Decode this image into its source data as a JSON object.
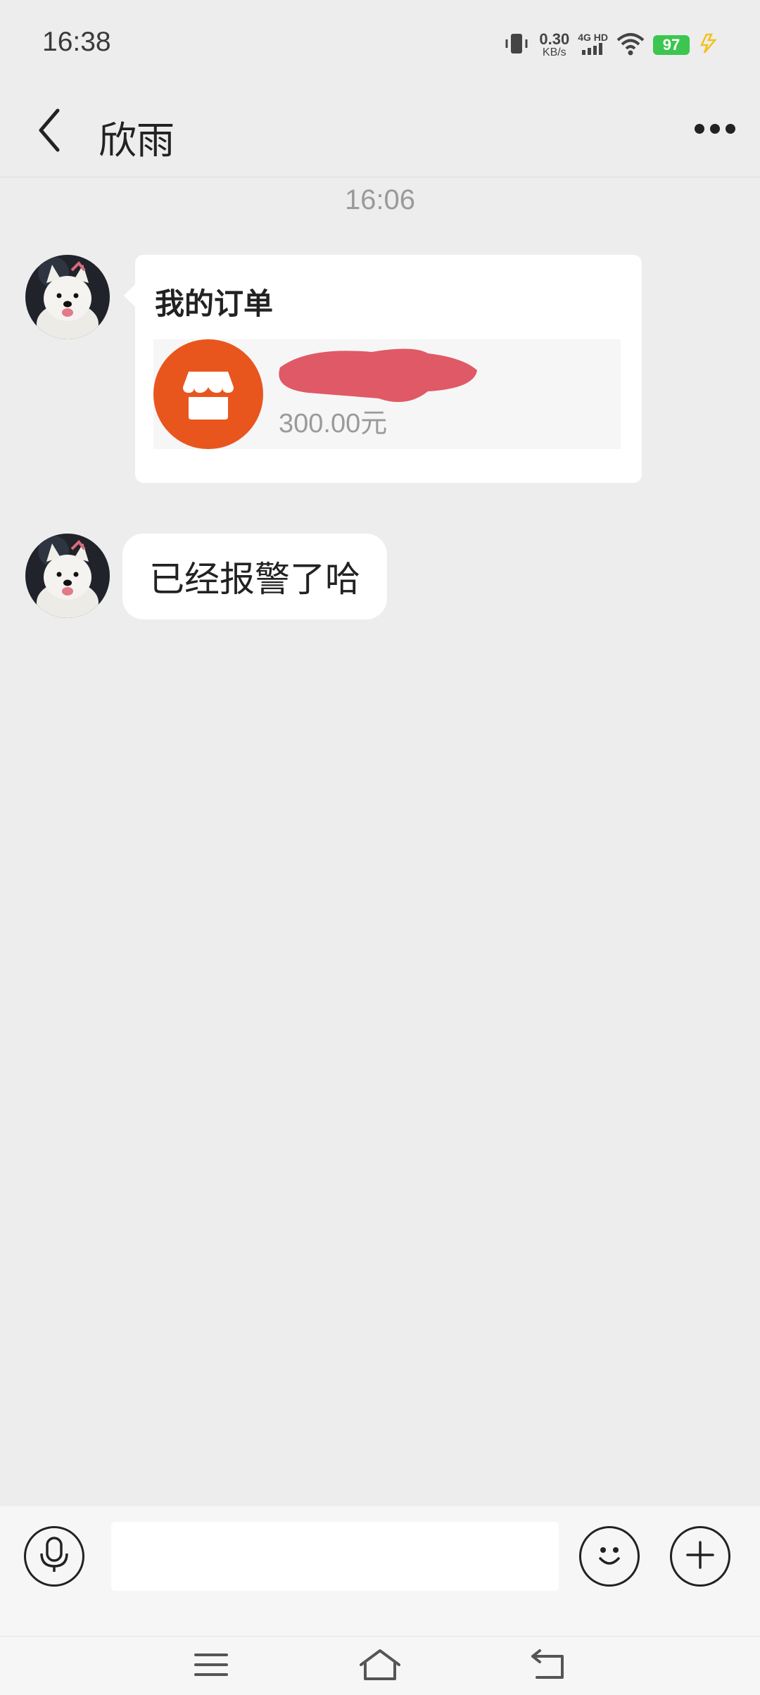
{
  "status_bar": {
    "time": "16:38",
    "net_speed_value": "0.30",
    "net_speed_unit": "KB/s",
    "network_type": "4G HD",
    "battery_level": "97",
    "battery_color": "#3cc64f",
    "icons": [
      "vibrate-icon",
      "signal-icon",
      "wifi-icon",
      "battery-icon",
      "charging-icon"
    ]
  },
  "header": {
    "title": "欣雨",
    "back_icon": "chevron-left-icon",
    "more_icon": "more-dots-icon"
  },
  "chat": {
    "timestamp": "16:06",
    "messages": [
      {
        "type": "order_card",
        "title": "我的订单",
        "price": "300.00元",
        "icon": "shop-icon",
        "accent": "#e8561e"
      },
      {
        "type": "text",
        "text": "已经报警了哈"
      }
    ]
  },
  "input_bar": {
    "voice_icon": "microphone-icon",
    "input_value": "",
    "emoji_icon": "smiley-icon",
    "plus_icon": "plus-icon"
  },
  "nav_bar": {
    "icons": [
      "menu-icon",
      "home-icon",
      "back-nav-icon"
    ]
  }
}
